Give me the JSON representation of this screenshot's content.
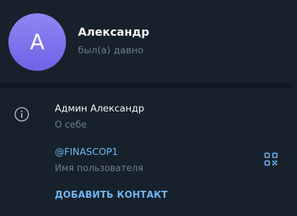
{
  "profile": {
    "avatar_letter": "А",
    "name": "Александр",
    "status": "был(а) давно",
    "avatar_gradient": [
      "#8f86f4",
      "#6e63e6"
    ]
  },
  "info": {
    "bio_text": "Админ Александр",
    "bio_label": "О себе",
    "username": "@FINASCOP1",
    "username_label": "Имя пользователя"
  },
  "actions": {
    "add_contact": "ДОБАВИТЬ КОНТАКТ"
  },
  "icons": {
    "info": "info-icon",
    "qr": "qr-code-icon"
  },
  "colors": {
    "background": "#17212b",
    "separator": "#101921",
    "accent": "#71b7f5",
    "muted": "#6d7f8f",
    "text": "#f5f5f5"
  }
}
